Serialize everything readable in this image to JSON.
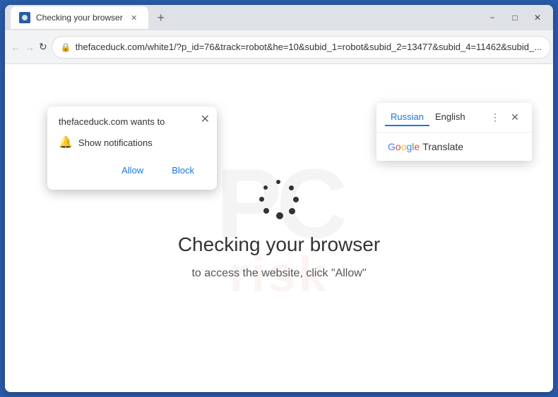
{
  "browser": {
    "title": "Checking your browser",
    "tab_label": "Checking your browser",
    "url": "thefaceduck.com/white1/?p_id=76&track=robot&he=10&subid_1=robot&subid_2=13477&subid_4=11462&subid_...",
    "new_tab_icon": "+",
    "window_controls": {
      "minimize": "−",
      "maximize": "□",
      "close": "✕"
    },
    "nav": {
      "back": "←",
      "forward": "→",
      "refresh": "↻"
    }
  },
  "notification_popup": {
    "header": "thefaceduck.com wants to",
    "close_icon": "✕",
    "bell_icon": "🔔",
    "show_notifications": "Show notifications",
    "allow_label": "Allow",
    "block_label": "Block"
  },
  "translate_popup": {
    "tab_russian": "Russian",
    "tab_english": "English",
    "more_icon": "⋮",
    "close_icon": "✕",
    "google_label": "Google",
    "translate_label": "Translate"
  },
  "page": {
    "spinner_dots": 8,
    "title": "Checking your browser",
    "subtitle": "to access the website, click \"Allow\"",
    "watermark_top": "PC",
    "watermark_bottom": "risk"
  }
}
